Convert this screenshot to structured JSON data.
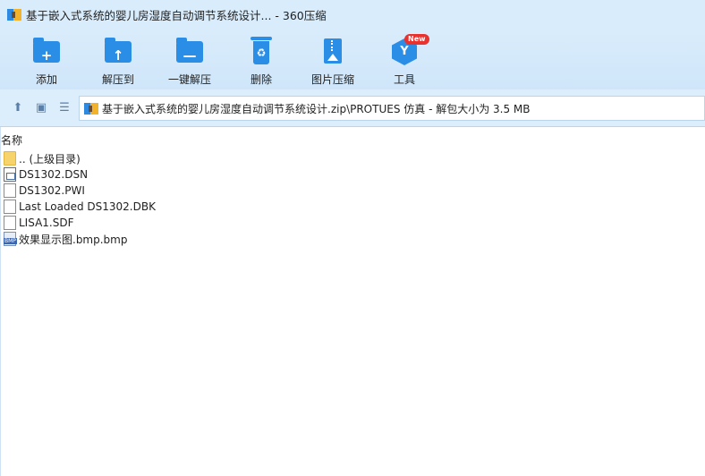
{
  "window": {
    "title": "基于嵌入式系统的婴儿房湿度自动调节系统设计... - 360压缩"
  },
  "toolbar": [
    {
      "label": "添加",
      "icon": "add-folder-icon",
      "glyph": "+"
    },
    {
      "label": "解压到",
      "icon": "extract-to-folder-icon",
      "glyph": "↑"
    },
    {
      "label": "一键解压",
      "icon": "one-click-extract-icon",
      "glyph": "—"
    },
    {
      "label": "删除",
      "icon": "recycle-bin-icon",
      "glyph": "♻"
    },
    {
      "label": "图片压缩",
      "icon": "image-compress-icon",
      "glyph": ""
    },
    {
      "label": "工具",
      "icon": "tools-icon",
      "glyph": "Y",
      "badge": "New"
    }
  ],
  "nav": {
    "up_icon": "up-arrow-icon",
    "view_icon": "thumbnail-view-icon",
    "list_icon": "list-view-icon",
    "path": "基于嵌入式系统的婴儿房湿度自动调节系统设计.zip\\PROTUES 仿真 - 解包大小为 3.5 MB"
  },
  "list": {
    "column_header": "名称",
    "items": [
      {
        "name": ".. (上级目录)",
        "icon": "folder-icon"
      },
      {
        "name": "DS1302.DSN",
        "icon": "dsn-file-icon"
      },
      {
        "name": "DS1302.PWI",
        "icon": "file-icon"
      },
      {
        "name": "Last Loaded DS1302.DBK",
        "icon": "file-icon"
      },
      {
        "name": "LISA1.SDF",
        "icon": "file-icon"
      },
      {
        "name": "效果显示图.bmp.bmp",
        "icon": "bmp-file-icon",
        "tag": "BMP"
      }
    ]
  },
  "colors": {
    "titlebar": "#d9ecfb",
    "accent": "#2b8ee6",
    "badge": "#e8322f"
  }
}
